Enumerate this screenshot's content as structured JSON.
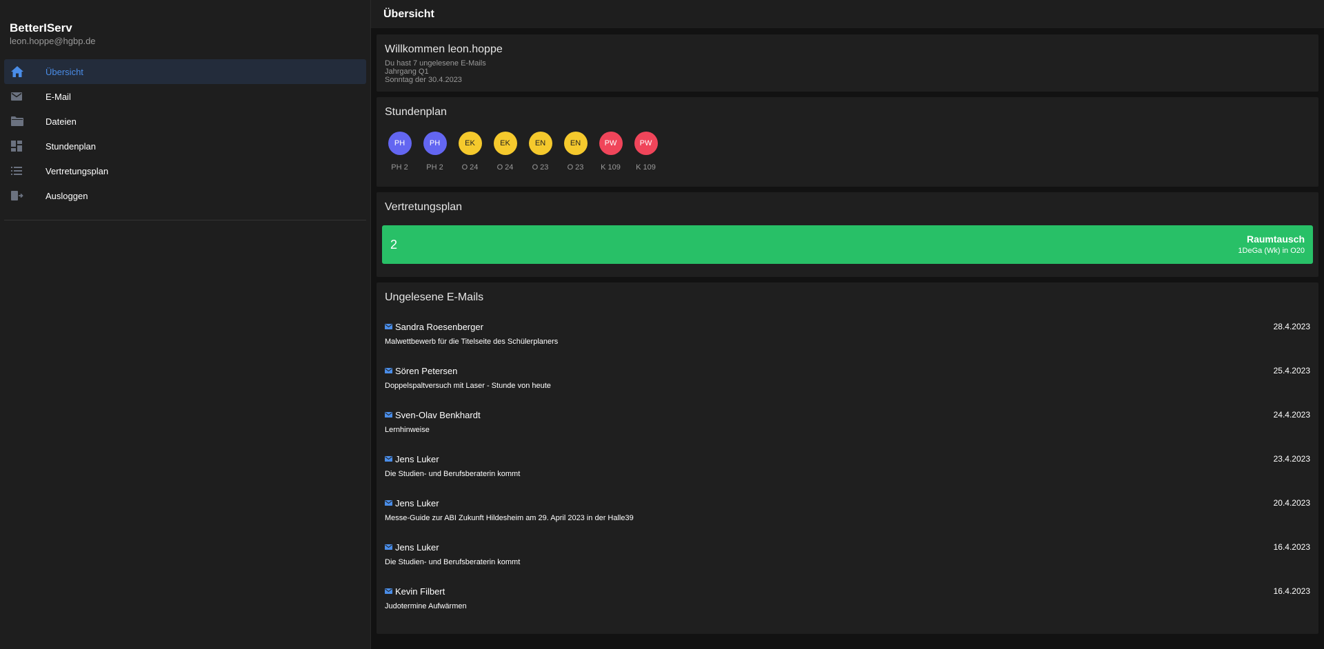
{
  "brand": {
    "title": "BetterIServ",
    "email": "leon.hoppe@hgbp.de"
  },
  "nav": {
    "items": [
      {
        "label": "Übersicht",
        "icon": "home-icon",
        "active": true
      },
      {
        "label": "E-Mail",
        "icon": "mail-icon",
        "active": false
      },
      {
        "label": "Dateien",
        "icon": "folder-icon",
        "active": false
      },
      {
        "label": "Stundenplan",
        "icon": "grid-icon",
        "active": false
      },
      {
        "label": "Vertretungsplan",
        "icon": "list-icon",
        "active": false
      },
      {
        "label": "Ausloggen",
        "icon": "logout-icon",
        "active": false
      }
    ]
  },
  "topbar": {
    "title": "Übersicht"
  },
  "welcome": {
    "title": "Willkommen leon.hoppe",
    "lines": [
      "Du hast 7 ungelesene E-Mails",
      "Jahrgang Q1",
      "Sonntag der 30.4.2023"
    ]
  },
  "schedule": {
    "title": "Stundenplan",
    "lessons": [
      {
        "subject": "PH",
        "room": "PH 2",
        "color": "#6366f1",
        "text_color": "#ffffff"
      },
      {
        "subject": "PH",
        "room": "PH 2",
        "color": "#6366f1",
        "text_color": "#ffffff"
      },
      {
        "subject": "EK",
        "room": "O 24",
        "color": "#f5c92d",
        "text_color": "#1e1e1e"
      },
      {
        "subject": "EK",
        "room": "O 24",
        "color": "#f5c92d",
        "text_color": "#1e1e1e"
      },
      {
        "subject": "EN",
        "room": "O 23",
        "color": "#f5c92d",
        "text_color": "#1e1e1e"
      },
      {
        "subject": "EN",
        "room": "O 23",
        "color": "#f5c92d",
        "text_color": "#1e1e1e"
      },
      {
        "subject": "PW",
        "room": "K 109",
        "color": "#f0455a",
        "text_color": "#ffffff"
      },
      {
        "subject": "PW",
        "room": "K 109",
        "color": "#f0455a",
        "text_color": "#ffffff"
      }
    ]
  },
  "substitution": {
    "title": "Vertretungsplan",
    "entry": {
      "lesson": "2",
      "type": "Raumtausch",
      "detail": "1DeGa (Wk) in O20",
      "color": "#28c067"
    }
  },
  "emails": {
    "title": "Ungelesene E-Mails",
    "items": [
      {
        "sender": "Sandra Roesenberger",
        "date": "28.4.2023",
        "subject": "Malwettbewerb für die Titelseite des Schülerplaners"
      },
      {
        "sender": "Sören Petersen",
        "date": "25.4.2023",
        "subject": "Doppelspaltversuch mit Laser - Stunde von heute"
      },
      {
        "sender": "Sven-Olav Benkhardt",
        "date": "24.4.2023",
        "subject": "Lernhinweise"
      },
      {
        "sender": "Jens Luker",
        "date": "23.4.2023",
        "subject": "Die Studien- und Berufsberaterin kommt"
      },
      {
        "sender": "Jens Luker",
        "date": "20.4.2023",
        "subject": "Messe-Guide zur ABI Zukunft Hildesheim am 29. April 2023 in der Halle39"
      },
      {
        "sender": "Jens Luker",
        "date": "16.4.2023",
        "subject": "Die Studien- und Berufsberaterin kommt"
      },
      {
        "sender": "Kevin Filbert",
        "date": "16.4.2023",
        "subject": "Judotermine Aufwärmen"
      }
    ]
  },
  "colors": {
    "accent": "#4a8de8",
    "mail_icon": "#4a8de8"
  }
}
